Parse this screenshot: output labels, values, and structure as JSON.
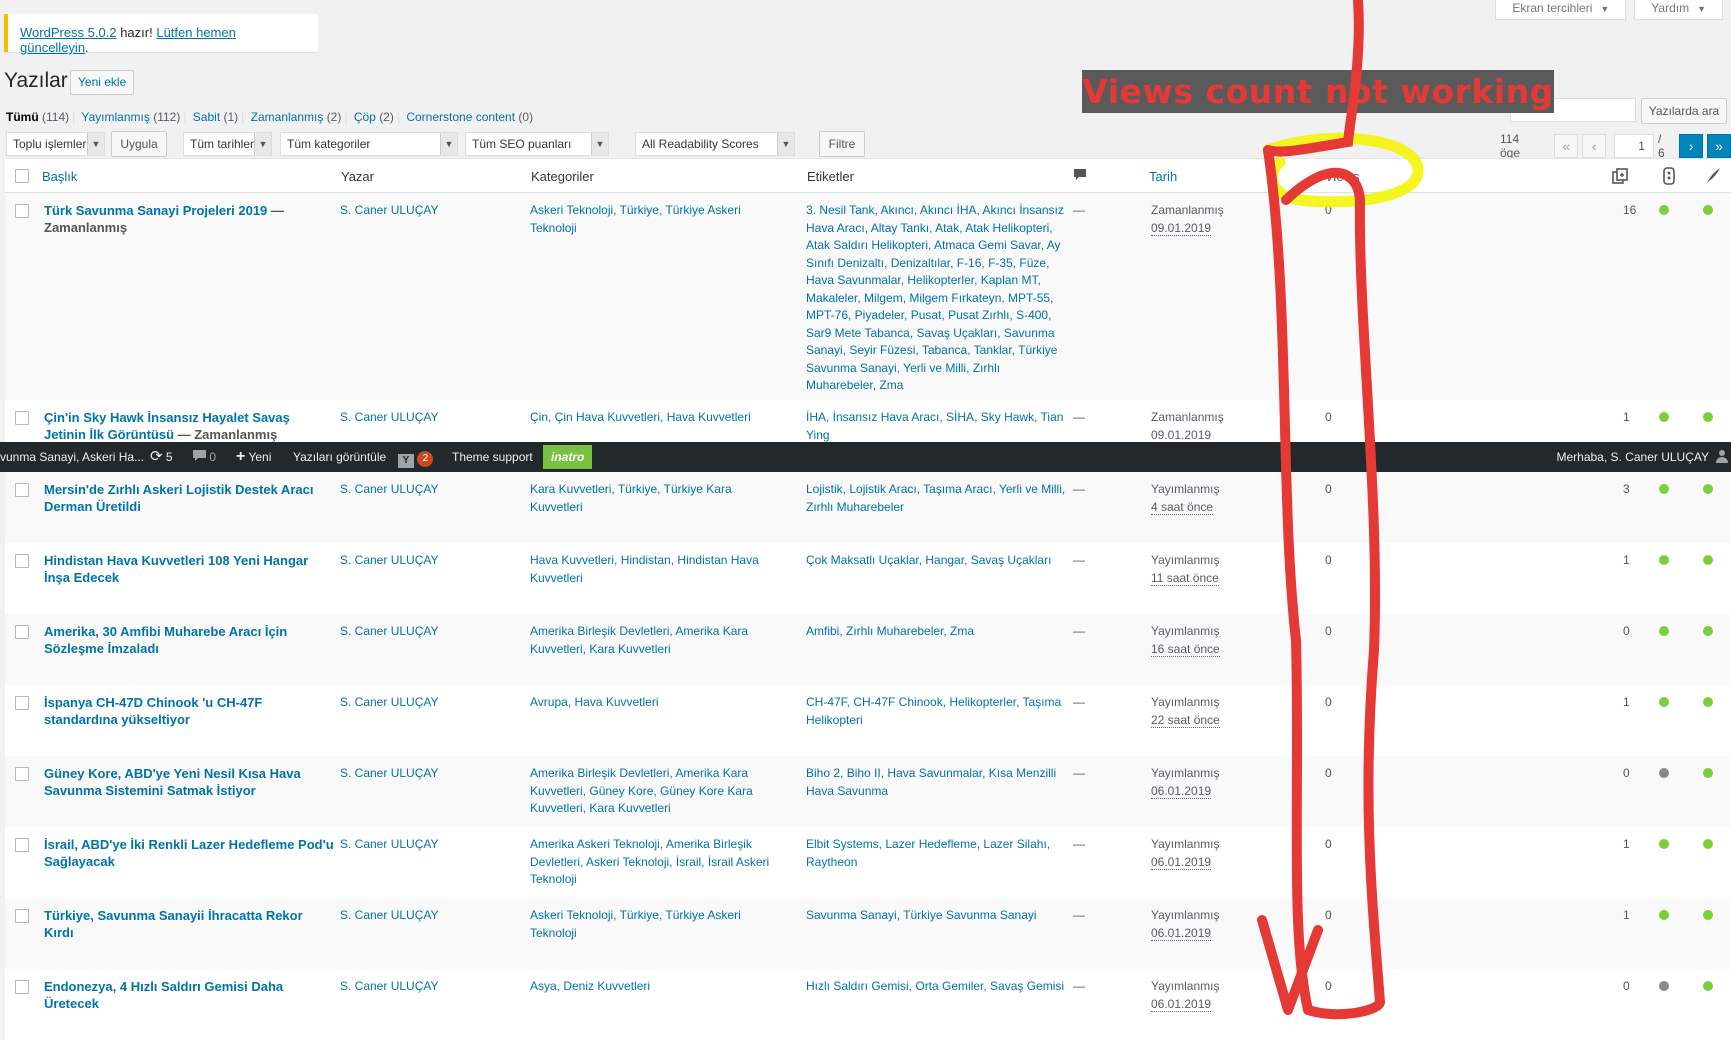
{
  "screen_options": {
    "screen_prefs": "Ekran tercihleri",
    "help": "Yardım"
  },
  "notice": {
    "link1": "WordPress 5.0.2",
    "mid": " hazır! ",
    "link2": "Lütfen hemen güncelleyin",
    "end": "."
  },
  "page": {
    "title": "Yazılar",
    "add_new": "Yeni ekle"
  },
  "filters_links": {
    "all": "Tümü",
    "all_count": "(114)",
    "published": "Yayımlanmış",
    "published_count": "(112)",
    "sticky": "Sabit",
    "sticky_count": "(1)",
    "scheduled": "Zamanlanmış",
    "scheduled_count": "(2)",
    "trash": "Çöp",
    "trash_count": "(2)",
    "cornerstone": "Cornerstone content",
    "cornerstone_count": "(0)"
  },
  "search": {
    "button": "Yazılarda ara",
    "value": ""
  },
  "toolbar": {
    "bulk": "Toplu işlemler",
    "apply": "Uygula",
    "dates": "Tüm tarihler",
    "categories": "Tüm kategoriler",
    "seo": "Tüm SEO puanları",
    "readability": "All Readability Scores",
    "filter": "Filtre"
  },
  "pagination": {
    "items": "114 öge",
    "first": "«",
    "prev": "‹",
    "current": "1",
    "total": "/ 6",
    "next": "›",
    "last": "»"
  },
  "columns": {
    "title": "Başlık",
    "author": "Yazar",
    "categories": "Kategoriler",
    "tags": "Etiketler",
    "date": "Tarih",
    "views": "Views"
  },
  "posts": [
    {
      "title": "Türk Savunma Sanayi Projeleri 2019",
      "state": " — Zamanlanmış",
      "author": "S. Caner ULUÇAY",
      "categories": "Askeri Teknoloji, Türkiye, Türkiye Askeri Teknoloji",
      "tags": "3. Nesil Tank, Akıncı, Akıncı İHA, Akıncı İnsansız Hava Aracı, Altay Tankı, Atak, Atak Helikopteri, Atak Saldırı Helikopteri, Atmaca Gemi Savar, Ay Sınıfı Denizaltı, Denizaltılar, F-16, F-35, Füze, Hava Savunmalar, Helikopterler, Kaplan MT, Makaleler, Milgem, Milgem Fırkateyn, MPT-55, MPT-76, Piyadeler, Pusat, Pusat Zırhlı, S-400, Sar9 Mete Tabanca, Savaş Uçakları, Savunma Sanayi, Seyir Füzesi, Tabanca, Tanklar, Türkiye Savunma Sanayi, Yerli ve Milli, Zırhlı Muharebeler, Zma",
      "comments": "—",
      "status": "Zamanlanmış",
      "when": "09.01.2019",
      "views": "0",
      "count": "16",
      "seo": "green",
      "readability": "green"
    },
    {
      "title": "Çin'in Sky Hawk İnsansız Hayalet Savaş Jetinin İlk Görüntüsü",
      "state": " — Zamanlanmış",
      "author": "S. Caner ULUÇAY",
      "categories": "Çin, Çin Hava Kuvvetleri, Hava Kuvvetleri",
      "tags": "İHA, İnsansız Hava Aracı, SİHA, Sky Hawk, Tian Ying",
      "comments": "—",
      "status": "Zamanlanmış",
      "when": "09.01.2019",
      "views": "0",
      "count": "1",
      "seo": "green",
      "readability": "green"
    },
    {
      "title": "Mersin'de Zırhlı Askeri Lojistik Destek Aracı Derman Üretildi",
      "state": "",
      "author": "S. Caner ULUÇAY",
      "categories": "Kara Kuvvetleri, Türkiye, Türkiye Kara Kuvvetleri",
      "tags": "Lojistik, Lojistik Aracı, Taşıma Aracı, Yerli ve Milli, Zırhlı Muharebeler",
      "comments": "—",
      "status": "Yayımlanmış",
      "when": "4 saat önce",
      "views": "0",
      "count": "3",
      "seo": "green",
      "readability": "green"
    },
    {
      "title": "Hindistan Hava Kuvvetleri 108 Yeni Hangar İnşa Edecek",
      "state": "",
      "author": "S. Caner ULUÇAY",
      "categories": "Hava Kuvvetleri, Hindistan, Hindistan Hava Kuvvetleri",
      "tags": "Çok Maksatlı Uçaklar, Hangar, Savaş Uçakları",
      "comments": "—",
      "status": "Yayımlanmış",
      "when": "11 saat önce",
      "views": "0",
      "count": "1",
      "seo": "green",
      "readability": "green"
    },
    {
      "title": "Amerika, 30 Amfibi Muharebe Aracı İçin Sözleşme İmzaladı",
      "state": "",
      "author": "S. Caner ULUÇAY",
      "categories": "Amerika Birleşik Devletleri, Amerika Kara Kuvvetleri, Kara Kuvvetleri",
      "tags": "Amfibi, Zırhlı Muharebeler, Zma",
      "comments": "—",
      "status": "Yayımlanmış",
      "when": "16 saat önce",
      "views": "0",
      "count": "0",
      "seo": "green",
      "readability": "green"
    },
    {
      "title": "İspanya CH-47D Chinook 'u CH-47F standardına yükseltiyor",
      "state": "",
      "author": "S. Caner ULUÇAY",
      "categories": "Avrupa, Hava Kuvvetleri",
      "tags": "CH-47F, CH-47F Chinook, Helikopterler, Taşıma Helikopteri",
      "comments": "—",
      "status": "Yayımlanmış",
      "when": "22 saat önce",
      "views": "0",
      "count": "1",
      "seo": "green",
      "readability": "green"
    },
    {
      "title": "Güney Kore, ABD'ye Yeni Nesil Kısa Hava Savunma Sistemini Satmak İstiyor",
      "state": "",
      "author": "S. Caner ULUÇAY",
      "categories": "Amerika Birleşik Devletleri, Amerika Kara Kuvvetleri, Güney Kore, Güney Kore Kara Kuvvetleri, Kara Kuvvetleri",
      "tags": "Biho 2, Biho II, Hava Savunmalar, Kısa Menzilli Hava Savunma",
      "comments": "—",
      "status": "Yayımlanmış",
      "when": "06.01.2019",
      "views": "0",
      "count": "0",
      "seo": "gray",
      "readability": "green"
    },
    {
      "title": "İsrail, ABD'ye İki Renkli Lazer Hedefleme Pod'u Sağlayacak",
      "state": "",
      "author": "S. Caner ULUÇAY",
      "categories": "Amerika Askeri Teknoloji, Amerika Birleşik Devletleri, Askeri Teknoloji, İsrail, İsrail Askeri Teknoloji",
      "tags": "Elbit Systems, Lazer Hedefleme, Lazer Silahı, Raytheon",
      "comments": "—",
      "status": "Yayımlanmış",
      "when": "06.01.2019",
      "views": "0",
      "count": "1",
      "seo": "green",
      "readability": "green"
    },
    {
      "title": "Türkiye, Savunma Sanayii İhracatta Rekor Kırdı",
      "state": "",
      "author": "S. Caner ULUÇAY",
      "categories": "Askeri Teknoloji, Türkiye, Türkiye Askeri Teknoloji",
      "tags": "Savunma Sanayi, Türkiye Savunma Sanayi",
      "comments": "—",
      "status": "Yayımlanmış",
      "when": "06.01.2019",
      "views": "0",
      "count": "1",
      "seo": "green",
      "readability": "green"
    },
    {
      "title": "Endonezya, 4 Hızlı Saldırı Gemisi Daha Üretecek",
      "state": "",
      "author": "S. Caner ULUÇAY",
      "categories": "Asya, Deniz Kuvvetleri",
      "tags": "Hızlı Saldırı Gemisi, Orta Gemiler, Savaş Gemisi",
      "comments": "—",
      "status": "Yayımlanmış",
      "when": "06.01.2019",
      "views": "0",
      "count": "0",
      "seo": "gray",
      "readability": "green"
    }
  ],
  "adminbar": {
    "site": "vunma Sanayi, Askeri Ha...",
    "updates": "5",
    "comments": "0",
    "new": "Yeni",
    "view_posts": "Yazıları görüntüle",
    "yoast_badge": "2",
    "theme_support": "Theme support",
    "brand": "inatro",
    "greeting": "Merhaba, S. Caner ULUÇAY"
  },
  "annotation": {
    "text": "Views count not working",
    "color": "#e53935"
  },
  "colors": {
    "link": "#0073aa",
    "green": "#7ad03a",
    "gray": "#888888",
    "annotation_yellow": "#f4f40a",
    "annotation_red": "#e53935"
  }
}
